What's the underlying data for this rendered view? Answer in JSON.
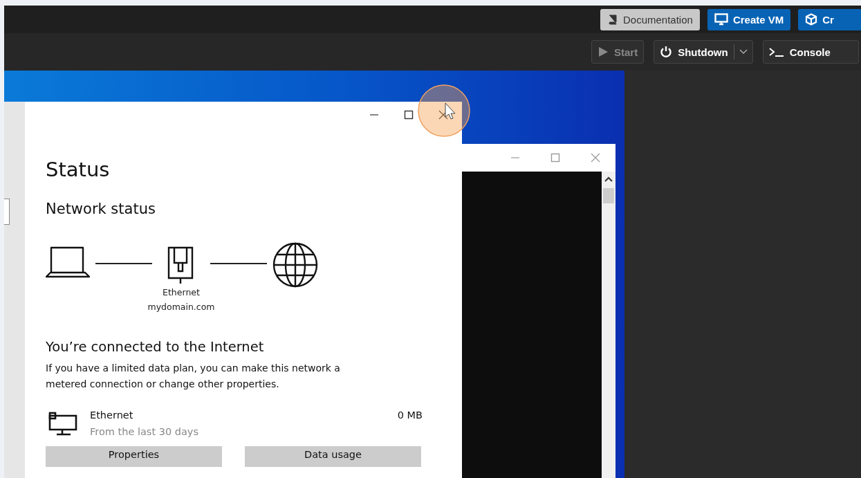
{
  "header": {
    "buttons": [
      {
        "label": "Documentation",
        "kind": "doc"
      },
      {
        "label": "Create VM",
        "kind": "create-vm"
      },
      {
        "label": "Cr",
        "kind": "create-ct"
      }
    ]
  },
  "toolbar": {
    "buttons": [
      {
        "label": "Start",
        "kind": "start",
        "disabled": true,
        "split": false
      },
      {
        "label": "Shutdown",
        "kind": "shutdown",
        "disabled": false,
        "split": true
      },
      {
        "label": "Console",
        "kind": "console",
        "disabled": false,
        "split": false
      }
    ]
  },
  "console": {
    "settings_window": {
      "title": "Status",
      "section": "Network status",
      "diagram": {
        "adapter_label": "Ethernet",
        "network_name": "mydomain.com"
      },
      "connection_title": "You’re connected to the Internet",
      "description": "If you have a limited data plan, you can make this network a metered connection or change other properties.",
      "usage": {
        "name": "Ethernet",
        "period": "From the last 30 days",
        "amount": "0 MB"
      },
      "buttons": [
        "Properties",
        "Data usage"
      ]
    }
  }
}
